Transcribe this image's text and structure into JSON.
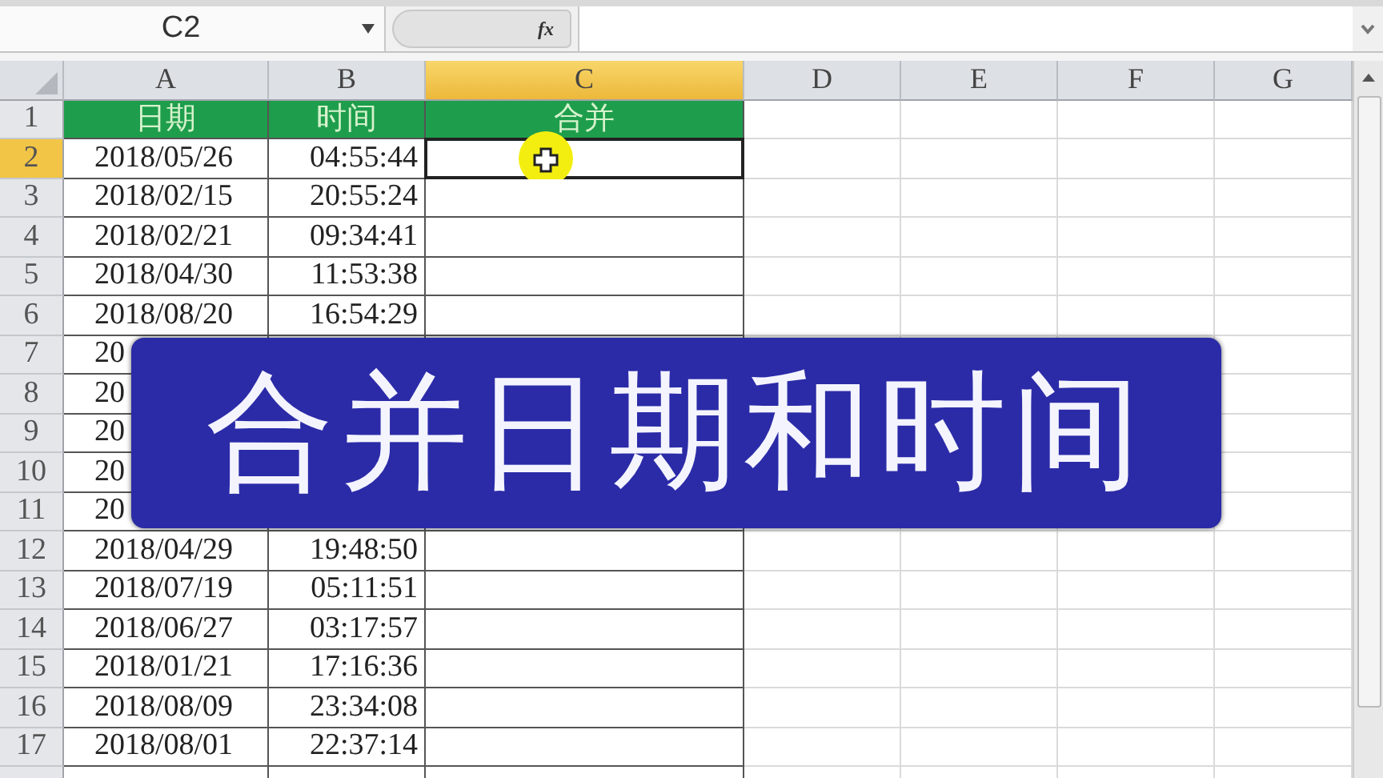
{
  "name_box": {
    "value": "C2"
  },
  "formula_bar": {
    "function_label": "fx"
  },
  "columns": [
    {
      "label": "A",
      "selected": false
    },
    {
      "label": "B",
      "selected": false
    },
    {
      "label": "C",
      "selected": true
    },
    {
      "label": "D",
      "selected": false
    },
    {
      "label": "E",
      "selected": false
    },
    {
      "label": "F",
      "selected": false
    },
    {
      "label": "G",
      "selected": false
    }
  ],
  "rows": [
    {
      "label": "1",
      "selected": false,
      "kind": "heading",
      "date": "日期",
      "time": "时间",
      "merged": "合并"
    },
    {
      "label": "2",
      "selected": true,
      "kind": "data",
      "date": "2018/05/26",
      "time": "04:55:44"
    },
    {
      "label": "3",
      "selected": false,
      "kind": "data",
      "date": "2018/02/15",
      "time": "20:55:24"
    },
    {
      "label": "4",
      "selected": false,
      "kind": "data",
      "date": "2018/02/21",
      "time": "09:34:41"
    },
    {
      "label": "5",
      "selected": false,
      "kind": "data",
      "date": "2018/04/30",
      "time": "11:53:38"
    },
    {
      "label": "6",
      "selected": false,
      "kind": "data",
      "date": "2018/08/20",
      "time": "16:54:29"
    },
    {
      "label": "7",
      "selected": false,
      "kind": "data",
      "date": "20"
    },
    {
      "label": "8",
      "selected": false,
      "kind": "data",
      "date": "20"
    },
    {
      "label": "9",
      "selected": false,
      "kind": "data",
      "date": "20"
    },
    {
      "label": "10",
      "selected": false,
      "kind": "data",
      "date": "20"
    },
    {
      "label": "11",
      "selected": false,
      "kind": "data",
      "date": "20"
    },
    {
      "label": "12",
      "selected": false,
      "kind": "data",
      "date": "2018/04/29",
      "time": "19:48:50"
    },
    {
      "label": "13",
      "selected": false,
      "kind": "data",
      "date": "2018/07/19",
      "time": "05:11:51"
    },
    {
      "label": "14",
      "selected": false,
      "kind": "data",
      "date": "2018/06/27",
      "time": "03:17:57"
    },
    {
      "label": "15",
      "selected": false,
      "kind": "data",
      "date": "2018/01/21",
      "time": "17:16:36"
    },
    {
      "label": "16",
      "selected": false,
      "kind": "data",
      "date": "2018/08/09",
      "time": "23:34:08"
    },
    {
      "label": "17",
      "selected": false,
      "kind": "data",
      "date": "2018/08/01",
      "time": "22:37:14"
    }
  ],
  "banner": {
    "title": "合并日期和时间"
  }
}
